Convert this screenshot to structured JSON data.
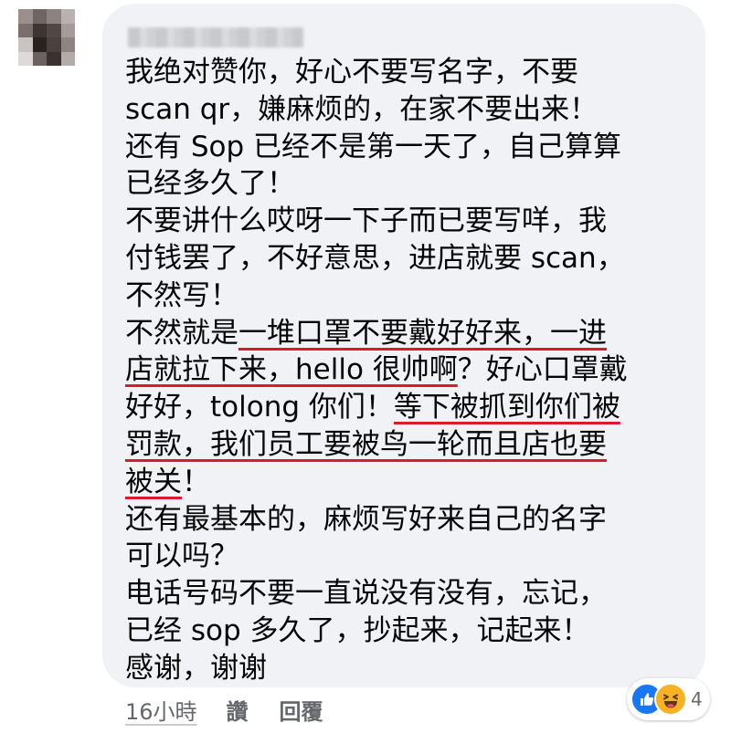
{
  "comment": {
    "author_name": "",
    "lines": [
      [
        {
          "t": "我绝对赞你，好心不要写名字，不要"
        }
      ],
      [
        {
          "t": "scan qr，嫌麻烦的，在家不要出来！"
        }
      ],
      [
        {
          "t": "还有 Sop 已经不是第一天了，自己算算"
        }
      ],
      [
        {
          "t": "已经多久了！"
        }
      ],
      [
        {
          "t": "不要讲什么哎呀一下子而已要写咩，我"
        }
      ],
      [
        {
          "t": "付钱罢了，不好意思，进店就要 scan，"
        }
      ],
      [
        {
          "t": "不然写！"
        }
      ],
      [
        {
          "t": "不然就是"
        },
        {
          "t": "一堆口罩不要戴好好来，一进",
          "u": true
        }
      ],
      [
        {
          "t": "店就拉下来，hello 很帅啊",
          "u": true
        },
        {
          "t": "？好心口罩戴"
        }
      ],
      [
        {
          "t": "好好，tolong 你们！"
        },
        {
          "t": "等下被抓到你们被",
          "u": true
        }
      ],
      [
        {
          "t": "罚款，我们员工要被鸟一轮而且店也要",
          "u": true
        }
      ],
      [
        {
          "t": "被关",
          "u": true
        },
        {
          "t": "！"
        }
      ],
      [
        {
          "t": "还有最基本的，麻烦写好来自己的名字"
        }
      ],
      [
        {
          "t": "可以吗？"
        }
      ],
      [
        {
          "t": "电话号码不要一直说没有没有，忘记，"
        }
      ],
      [
        {
          "t": "已经 sop 多久了，抄起来，记起来！"
        }
      ],
      [
        {
          "t": "感谢，谢谢"
        }
      ]
    ]
  },
  "footer": {
    "time": "16小時",
    "like_label": "讚",
    "reply_label": "回覆"
  },
  "reactions": {
    "types": [
      "like-icon",
      "haha-icon"
    ],
    "count": "4"
  },
  "colors": {
    "bubble": "#f0f2f5",
    "text": "#050505",
    "underline": "#e0182d",
    "meta": "#65676b",
    "like": "#1877f2",
    "haha": "#f7b125"
  }
}
